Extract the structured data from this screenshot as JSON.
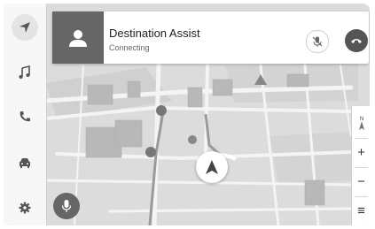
{
  "call": {
    "caller_name": "Destination Assist",
    "status": "Connecting"
  },
  "icons": {
    "sidebar": [
      "navigation-icon",
      "music-note-icon",
      "phone-icon",
      "car-icon",
      "gear-icon"
    ],
    "call": [
      "person-icon",
      "microphone-muted-icon",
      "hang-up-icon"
    ],
    "map_controls": [
      "compass-icon",
      "zoom-in-icon",
      "zoom-out-icon",
      "menu-icon"
    ],
    "other": [
      "voice-microphone-icon",
      "current-location-arrow-icon"
    ]
  },
  "map_controls": {
    "compass_label": "N",
    "zoom_in": "+",
    "zoom_out": "−",
    "menu": "≡"
  },
  "colors": {
    "map_background": "#dcdcdc",
    "road": "#f4f4f4",
    "route_block": "#b4b4b4",
    "avatar_bg": "#666666",
    "end_call_button": "#555555"
  }
}
